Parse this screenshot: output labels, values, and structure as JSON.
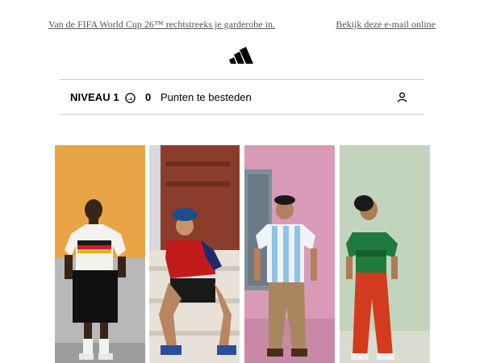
{
  "email": {
    "top_link_left": "Van de FIFA World Cup 26™ rechtstreeks je garderobe in.",
    "top_link_right": "Bekijk deze e-mail online"
  },
  "brand": {
    "logo_icon": "adidas-logo-icon"
  },
  "loyalty": {
    "level_label": "NIVEAU 1",
    "points_value": "0",
    "points_label": "Punten te besteden",
    "points_icon": "coin-icon",
    "account_icon": "user-icon"
  },
  "photos": [
    {
      "description_icon": "photo-germany-jersey",
      "bg": "#e9a445"
    },
    {
      "description_icon": "photo-spain-jersey",
      "bg": "#8b3d2b"
    },
    {
      "description_icon": "photo-argentina-jersey",
      "bg": "#d99ab8"
    },
    {
      "description_icon": "photo-mexico-jersey",
      "bg": "#c3d4bd"
    }
  ]
}
